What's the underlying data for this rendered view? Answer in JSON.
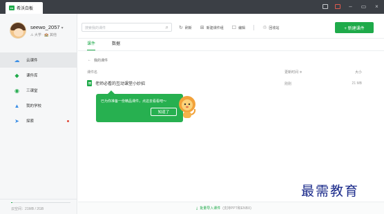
{
  "app": {
    "tab_title": "希沃白板",
    "logo_text": "en"
  },
  "titlebar": {
    "icons": [
      "user-icon",
      "message-icon",
      "minimize-icon",
      "maximize-icon",
      "close-icon"
    ]
  },
  "user": {
    "name": "seewo_2057",
    "caret": "▾",
    "meta": "⚠ 大学 · 🏫 其他"
  },
  "sidebar": {
    "items": [
      {
        "label": "云课件",
        "icon": "cloud-icon",
        "active": true
      },
      {
        "label": "课件库",
        "icon": "gem-icon",
        "active": false
      },
      {
        "label": "三课堂",
        "icon": "target-icon",
        "active": false
      },
      {
        "label": "我的学校",
        "icon": "school-icon",
        "active": false
      },
      {
        "label": "探索",
        "icon": "send-icon",
        "active": false,
        "badge": true
      }
    ],
    "storage": {
      "text": "云空间：21MB / 2GB",
      "used_fraction": 0.01
    }
  },
  "toolbar": {
    "search_placeholder": "搜索我的课件",
    "actions": [
      "刷新",
      "新建课件组",
      "编辑",
      "回收站"
    ],
    "new_button": "+ 新建课件"
  },
  "tabs": [
    {
      "label": "课件",
      "active": true
    },
    {
      "label": "数据",
      "active": false
    }
  ],
  "breadcrumb": {
    "back": "←",
    "label": "我的课件"
  },
  "table": {
    "headers": {
      "name": "课件名",
      "time": "更新时间 ≑",
      "size": "大小"
    },
    "rows": [
      {
        "name": "老师必看的互动课堂小妙招",
        "time": "刚刚",
        "size": "21 MB"
      }
    ]
  },
  "guide": {
    "text": "已为你准备一份精品课件，点这去看看吧～",
    "button": "知道了"
  },
  "footer": {
    "label": "批量导入课件",
    "hint": "(支持PPT和ENBX)"
  },
  "watermark": "最需教育",
  "colors": {
    "accent": "#1faa4a",
    "titlebar": "#3b3f45"
  }
}
